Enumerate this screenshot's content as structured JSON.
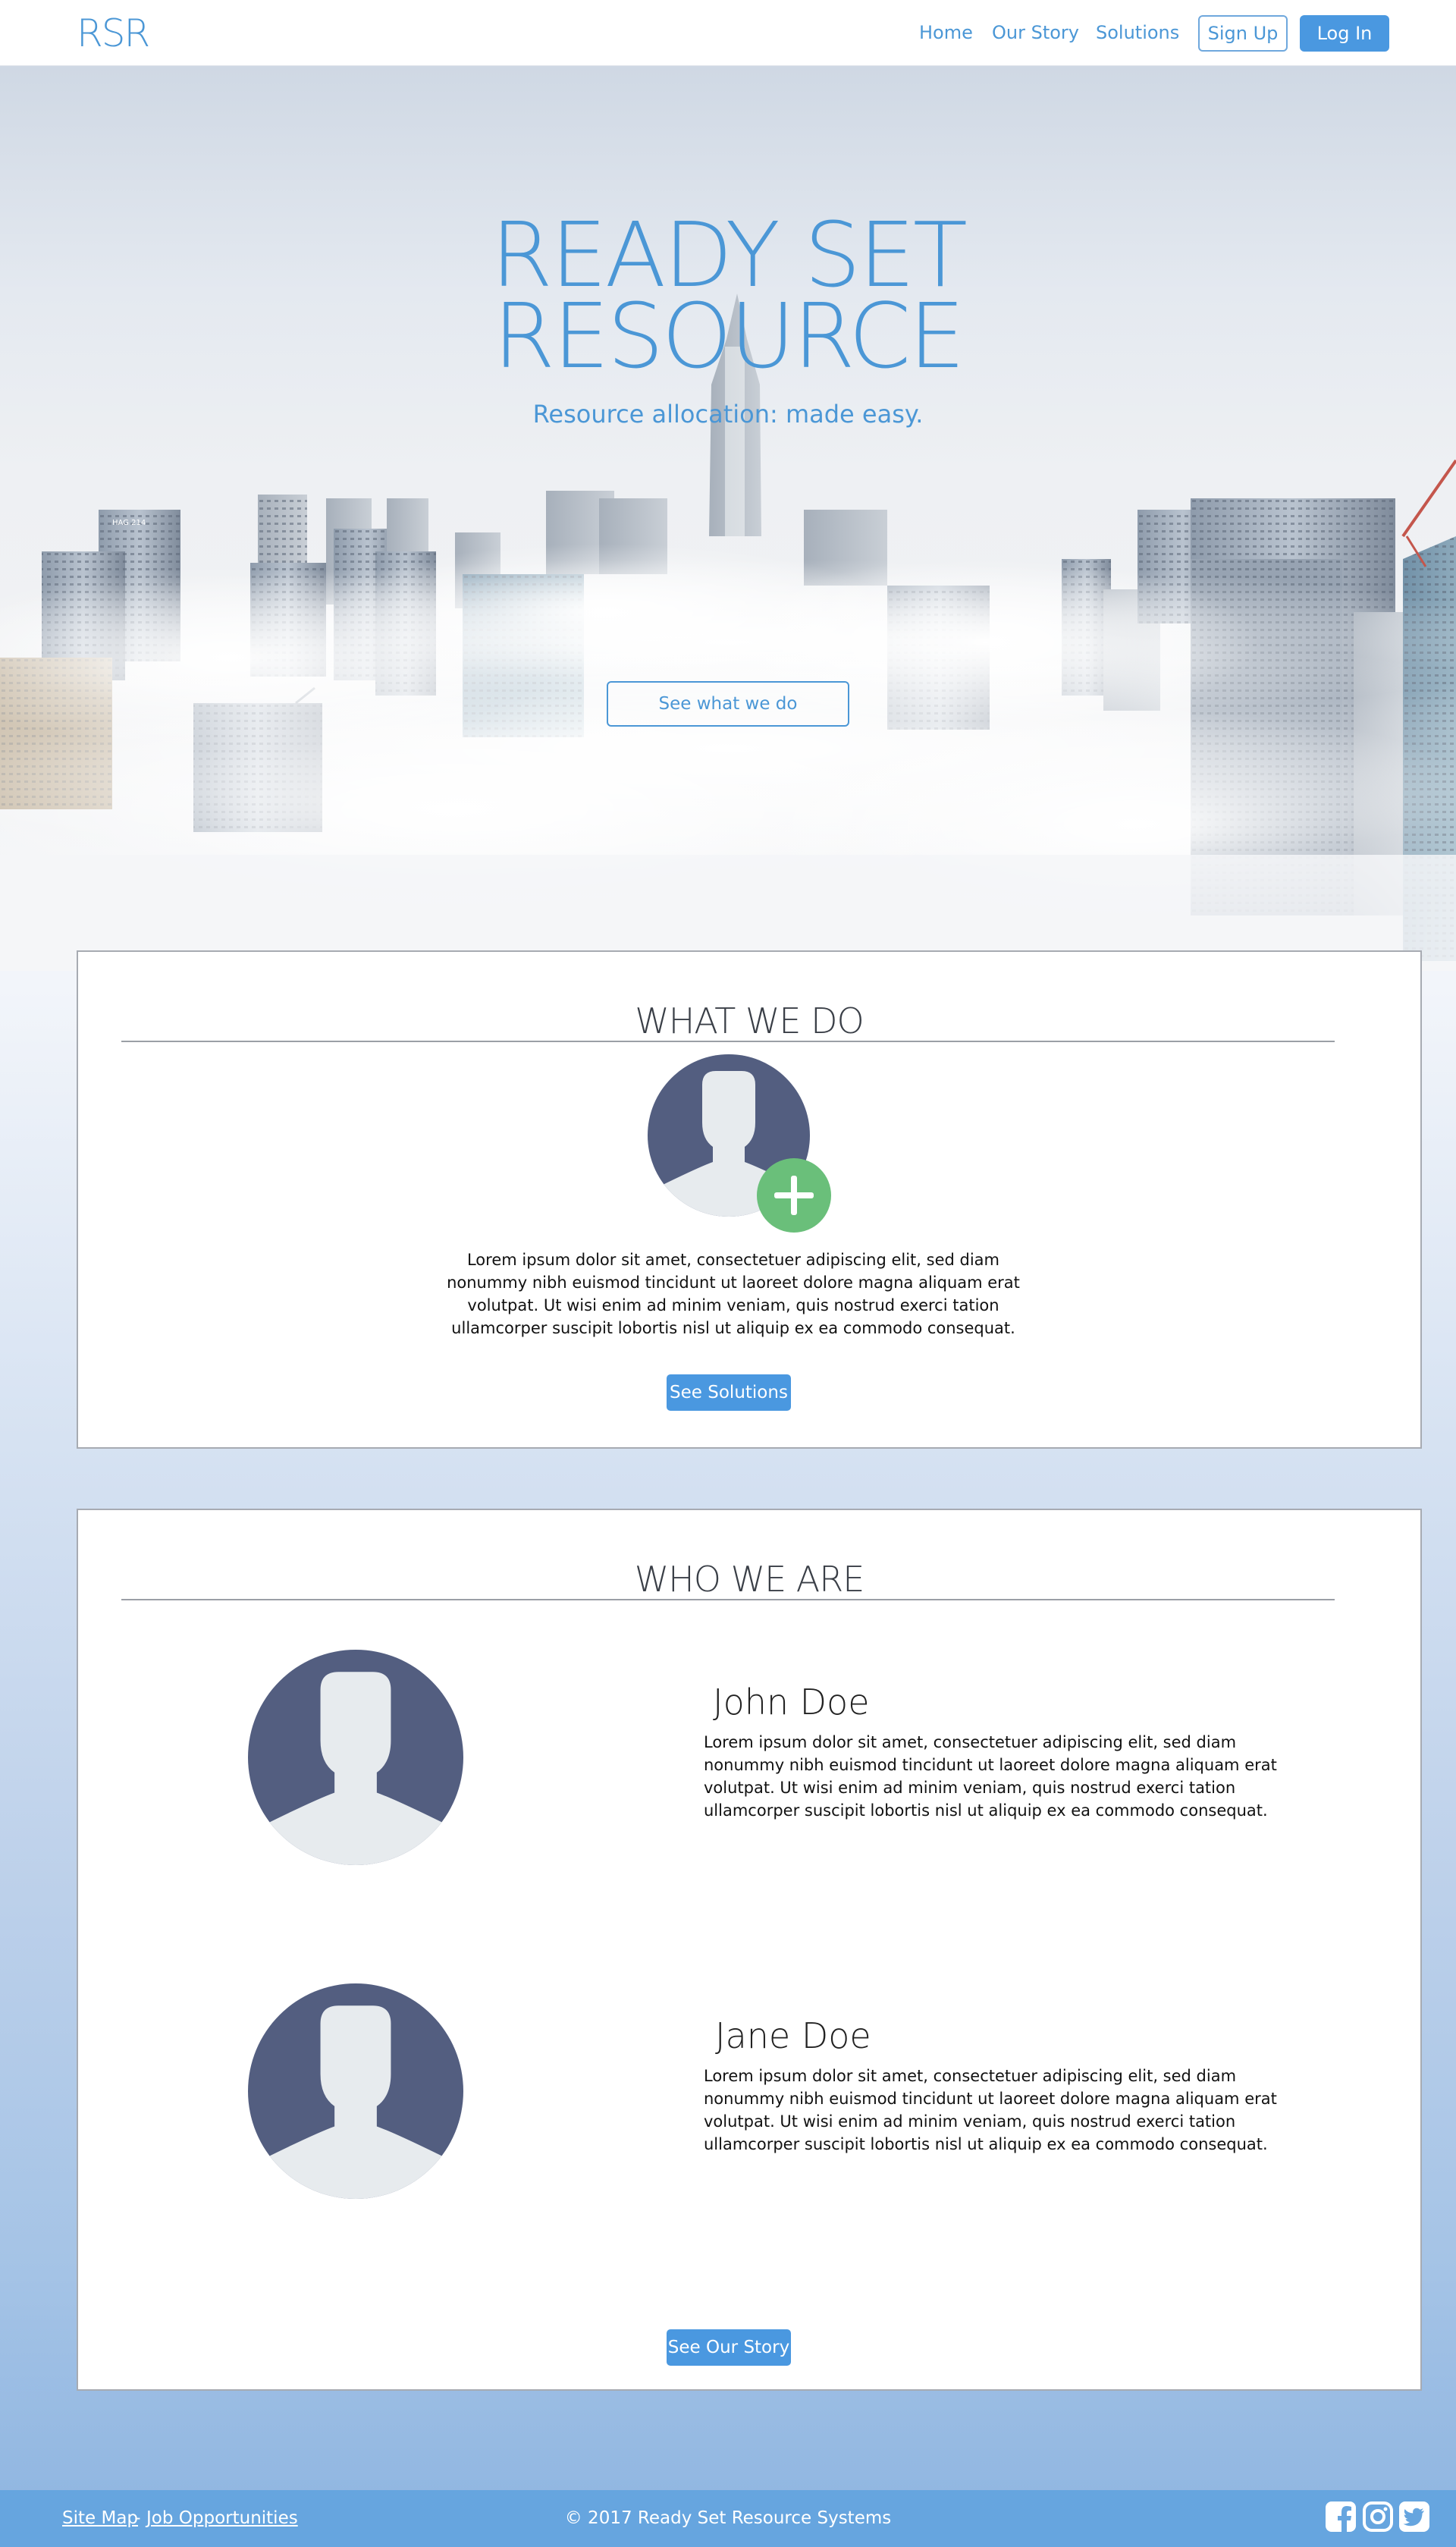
{
  "navbar": {
    "logo": "RSR",
    "links": [
      "Home",
      "Our Story",
      "Solutions"
    ],
    "signup_label": "Sign Up",
    "login_label": "Log In"
  },
  "hero": {
    "title_line1": "READY SET",
    "title_line2": "RESOURCE",
    "tagline": "Resource allocation: made easy.",
    "cta_label": "See what we do",
    "building_sign": "HAG 214"
  },
  "what_we_do": {
    "heading": "WHAT WE DO",
    "body": "Lorem ipsum dolor sit amet, consectetuer adipiscing elit, sed diam nonummy nibh euismod tincidunt ut laoreet dolore magna aliquam erat volutpat. Ut wisi enim ad minim veniam, quis nostrud exerci tation ullamcorper suscipit lobortis nisl ut aliquip ex ea commodo consequat.",
    "button_label": "See Solutions"
  },
  "who_we_are": {
    "heading": "WHO WE ARE",
    "people": [
      {
        "name": "John Doe",
        "bio": "Lorem ipsum dolor sit amet, consectetuer adipiscing elit, sed diam nonummy nibh euismod tincidunt ut laoreet dolore magna aliquam erat volutpat. Ut wisi enim ad minim veniam, quis nostrud exerci tation ullamcorper suscipit lobortis nisl ut aliquip ex ea commodo consequat."
      },
      {
        "name": "Jane Doe",
        "bio": "Lorem ipsum dolor sit amet, consectetuer adipiscing elit, sed diam nonummy nibh euismod tincidunt ut laoreet dolore magna aliquam erat volutpat. Ut wisi enim ad minim veniam, quis nostrud exerci tation ullamcorper suscipit lobortis nisl ut aliquip ex ea commodo consequat."
      }
    ],
    "button_label": "See Our Story"
  },
  "footer": {
    "site_map": "Site Map",
    "separator": " - ",
    "jobs": "Job Opportunities",
    "copyright": "© 2017 Ready Set Resource Systems",
    "social_icons": [
      "facebook-icon",
      "instagram-icon",
      "twitter-icon"
    ]
  },
  "colors": {
    "brand_blue": "#4b97d6",
    "button_blue": "#4a98e0",
    "avatar_navy": "#535e80",
    "avatar_light": "#e7ebee",
    "plus_green": "#6abf7a",
    "footer_blue": "#66a5df"
  }
}
